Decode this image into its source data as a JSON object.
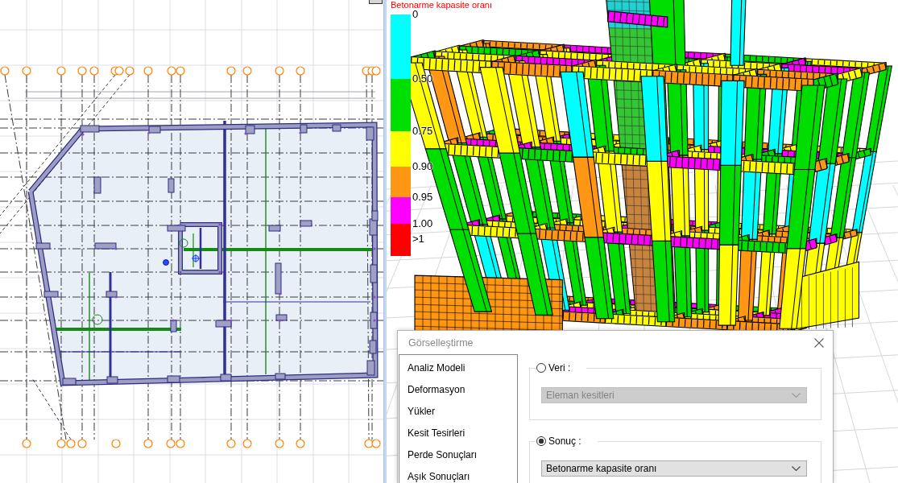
{
  "legend": {
    "title": "Betonarme kapasite oranı",
    "bands": [
      {
        "label": "0",
        "color": "#00ffff"
      },
      {
        "label": "0.50",
        "color": "#00e000"
      },
      {
        "label": "0.75",
        "color": "#ffff00"
      },
      {
        "label": "0.90",
        "color": "#ff9614"
      },
      {
        "label": "0.95",
        "color": "#ff00ff"
      },
      {
        "label": "1.00",
        "color": "#ff0000"
      }
    ],
    "overflow_label": ">1"
  },
  "dialog": {
    "title": "Görselleştirme",
    "categories": [
      {
        "label": "Analiz Modeli",
        "selected": false
      },
      {
        "label": "Deformasyon",
        "selected": false
      },
      {
        "label": "Yükler",
        "selected": false
      },
      {
        "label": "Kesit Tesirleri",
        "selected": false
      },
      {
        "label": "Perde Sonuçları",
        "selected": false
      },
      {
        "label": "Aşık Sonuçları",
        "selected": false
      }
    ],
    "groups": [
      {
        "label": "Veri :",
        "selected": false,
        "dropdown": {
          "value": "Eleman kesitleri",
          "disabled": true
        }
      },
      {
        "label": "Sonuç :",
        "selected": true,
        "dropdown": {
          "value": "Betonarme kapasite oranı",
          "disabled": false
        }
      }
    ]
  }
}
